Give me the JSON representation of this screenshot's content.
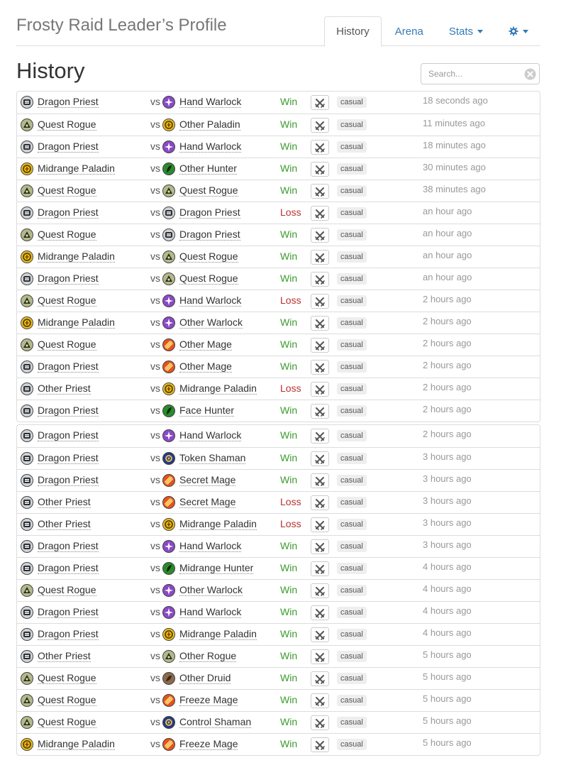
{
  "header": {
    "title": "Frosty Raid Leader’s Profile",
    "tabs": [
      {
        "label": "History",
        "active": true
      },
      {
        "label": "Arena",
        "active": false
      },
      {
        "label": "Stats",
        "active": false,
        "dropdown": true
      }
    ],
    "settings_icon": "gear-icon"
  },
  "page_title": "History",
  "search": {
    "placeholder": "Search...",
    "value": "",
    "clear_icon": "clear-icon"
  },
  "classes": {
    "priest": {
      "bg": "#cfd3d6",
      "fg": "#2b2f33",
      "glyph": "priest-icon"
    },
    "rogue": {
      "bg": "#b4b98a",
      "fg": "#2c2e1c",
      "glyph": "rogue-icon"
    },
    "paladin": {
      "bg": "#f0c21e",
      "fg": "#6b4a00",
      "glyph": "paladin-icon"
    },
    "warlock": {
      "bg": "#8b48c7",
      "fg": "#ffffff",
      "glyph": "warlock-icon"
    },
    "hunter": {
      "bg": "#2b8a2b",
      "fg": "#0b2b0b",
      "glyph": "hunter-icon"
    },
    "mage": {
      "bg": "#e6531c",
      "fg": "#ffe07a",
      "glyph": "mage-icon"
    },
    "shaman": {
      "bg": "#1e3a8a",
      "fg": "#e9b949",
      "glyph": "shaman-icon"
    },
    "druid": {
      "bg": "#8a6a4a",
      "fg": "#3a2616",
      "glyph": "druid-icon"
    }
  },
  "colors": {
    "win": "#3c9a2f",
    "loss": "#b93030",
    "link": "#337ab7"
  },
  "groups": [
    {
      "games": [
        {
          "player_class": "priest",
          "player_deck": "Dragon Priest",
          "vs": "vs",
          "opponent_class": "warlock",
          "opponent_deck": "Hand Warlock",
          "result": "Win",
          "mode": "casual",
          "time": "18 seconds ago"
        },
        {
          "player_class": "rogue",
          "player_deck": "Quest Rogue",
          "vs": "vs",
          "opponent_class": "paladin",
          "opponent_deck": "Other Paladin",
          "result": "Win",
          "mode": "casual",
          "time": "11 minutes ago"
        },
        {
          "player_class": "priest",
          "player_deck": "Dragon Priest",
          "vs": "vs",
          "opponent_class": "warlock",
          "opponent_deck": "Hand Warlock",
          "result": "Win",
          "mode": "casual",
          "time": "18 minutes ago"
        },
        {
          "player_class": "paladin",
          "player_deck": "Midrange Paladin",
          "vs": "vs",
          "opponent_class": "hunter",
          "opponent_deck": "Other Hunter",
          "result": "Win",
          "mode": "casual",
          "time": "30 minutes ago"
        },
        {
          "player_class": "rogue",
          "player_deck": "Quest Rogue",
          "vs": "vs",
          "opponent_class": "rogue",
          "opponent_deck": "Quest Rogue",
          "result": "Win",
          "mode": "casual",
          "time": "38 minutes ago"
        },
        {
          "player_class": "priest",
          "player_deck": "Dragon Priest",
          "vs": "vs",
          "opponent_class": "priest",
          "opponent_deck": "Dragon Priest",
          "result": "Loss",
          "mode": "casual",
          "time": "an hour ago"
        },
        {
          "player_class": "rogue",
          "player_deck": "Quest Rogue",
          "vs": "vs",
          "opponent_class": "priest",
          "opponent_deck": "Dragon Priest",
          "result": "Win",
          "mode": "casual",
          "time": "an hour ago"
        },
        {
          "player_class": "paladin",
          "player_deck": "Midrange Paladin",
          "vs": "vs",
          "opponent_class": "rogue",
          "opponent_deck": "Quest Rogue",
          "result": "Win",
          "mode": "casual",
          "time": "an hour ago"
        },
        {
          "player_class": "priest",
          "player_deck": "Dragon Priest",
          "vs": "vs",
          "opponent_class": "rogue",
          "opponent_deck": "Quest Rogue",
          "result": "Win",
          "mode": "casual",
          "time": "an hour ago"
        },
        {
          "player_class": "rogue",
          "player_deck": "Quest Rogue",
          "vs": "vs",
          "opponent_class": "warlock",
          "opponent_deck": "Hand Warlock",
          "result": "Loss",
          "mode": "casual",
          "time": "2 hours ago"
        },
        {
          "player_class": "paladin",
          "player_deck": "Midrange Paladin",
          "vs": "vs",
          "opponent_class": "warlock",
          "opponent_deck": "Other Warlock",
          "result": "Win",
          "mode": "casual",
          "time": "2 hours ago"
        },
        {
          "player_class": "rogue",
          "player_deck": "Quest Rogue",
          "vs": "vs",
          "opponent_class": "mage",
          "opponent_deck": "Other Mage",
          "result": "Win",
          "mode": "casual",
          "time": "2 hours ago"
        },
        {
          "player_class": "priest",
          "player_deck": "Dragon Priest",
          "vs": "vs",
          "opponent_class": "mage",
          "opponent_deck": "Other Mage",
          "result": "Win",
          "mode": "casual",
          "time": "2 hours ago"
        },
        {
          "player_class": "priest",
          "player_deck": "Other Priest",
          "vs": "vs",
          "opponent_class": "paladin",
          "opponent_deck": "Midrange Paladin",
          "result": "Loss",
          "mode": "casual",
          "time": "2 hours ago"
        },
        {
          "player_class": "priest",
          "player_deck": "Dragon Priest",
          "vs": "vs",
          "opponent_class": "hunter",
          "opponent_deck": "Face Hunter",
          "result": "Win",
          "mode": "casual",
          "time": "2 hours ago"
        }
      ]
    },
    {
      "games": [
        {
          "player_class": "priest",
          "player_deck": "Dragon Priest",
          "vs": "vs",
          "opponent_class": "warlock",
          "opponent_deck": "Hand Warlock",
          "result": "Win",
          "mode": "casual",
          "time": "2 hours ago"
        },
        {
          "player_class": "priest",
          "player_deck": "Dragon Priest",
          "vs": "vs",
          "opponent_class": "shaman",
          "opponent_deck": "Token Shaman",
          "result": "Win",
          "mode": "casual",
          "time": "3 hours ago"
        },
        {
          "player_class": "priest",
          "player_deck": "Dragon Priest",
          "vs": "vs",
          "opponent_class": "mage",
          "opponent_deck": "Secret Mage",
          "result": "Win",
          "mode": "casual",
          "time": "3 hours ago"
        },
        {
          "player_class": "priest",
          "player_deck": "Other Priest",
          "vs": "vs",
          "opponent_class": "mage",
          "opponent_deck": "Secret Mage",
          "result": "Loss",
          "mode": "casual",
          "time": "3 hours ago"
        },
        {
          "player_class": "priest",
          "player_deck": "Other Priest",
          "vs": "vs",
          "opponent_class": "paladin",
          "opponent_deck": "Midrange Paladin",
          "result": "Loss",
          "mode": "casual",
          "time": "3 hours ago"
        },
        {
          "player_class": "priest",
          "player_deck": "Dragon Priest",
          "vs": "vs",
          "opponent_class": "warlock",
          "opponent_deck": "Hand Warlock",
          "result": "Win",
          "mode": "casual",
          "time": "3 hours ago"
        },
        {
          "player_class": "priest",
          "player_deck": "Dragon Priest",
          "vs": "vs",
          "opponent_class": "hunter",
          "opponent_deck": "Midrange Hunter",
          "result": "Win",
          "mode": "casual",
          "time": "4 hours ago"
        },
        {
          "player_class": "rogue",
          "player_deck": "Quest Rogue",
          "vs": "vs",
          "opponent_class": "warlock",
          "opponent_deck": "Other Warlock",
          "result": "Win",
          "mode": "casual",
          "time": "4 hours ago"
        },
        {
          "player_class": "priest",
          "player_deck": "Dragon Priest",
          "vs": "vs",
          "opponent_class": "warlock",
          "opponent_deck": "Hand Warlock",
          "result": "Win",
          "mode": "casual",
          "time": "4 hours ago"
        },
        {
          "player_class": "priest",
          "player_deck": "Dragon Priest",
          "vs": "vs",
          "opponent_class": "paladin",
          "opponent_deck": "Midrange Paladin",
          "result": "Win",
          "mode": "casual",
          "time": "4 hours ago"
        },
        {
          "player_class": "priest",
          "player_deck": "Other Priest",
          "vs": "vs",
          "opponent_class": "rogue",
          "opponent_deck": "Other Rogue",
          "result": "Win",
          "mode": "casual",
          "time": "5 hours ago"
        },
        {
          "player_class": "rogue",
          "player_deck": "Quest Rogue",
          "vs": "vs",
          "opponent_class": "druid",
          "opponent_deck": "Other Druid",
          "result": "Win",
          "mode": "casual",
          "time": "5 hours ago"
        },
        {
          "player_class": "rogue",
          "player_deck": "Quest Rogue",
          "vs": "vs",
          "opponent_class": "mage",
          "opponent_deck": "Freeze Mage",
          "result": "Win",
          "mode": "casual",
          "time": "5 hours ago"
        },
        {
          "player_class": "rogue",
          "player_deck": "Quest Rogue",
          "vs": "vs",
          "opponent_class": "shaman",
          "opponent_deck": "Control Shaman",
          "result": "Win",
          "mode": "casual",
          "time": "5 hours ago"
        },
        {
          "player_class": "paladin",
          "player_deck": "Midrange Paladin",
          "vs": "vs",
          "opponent_class": "mage",
          "opponent_deck": "Freeze Mage",
          "result": "Win",
          "mode": "casual",
          "time": "5 hours ago"
        }
      ]
    }
  ]
}
